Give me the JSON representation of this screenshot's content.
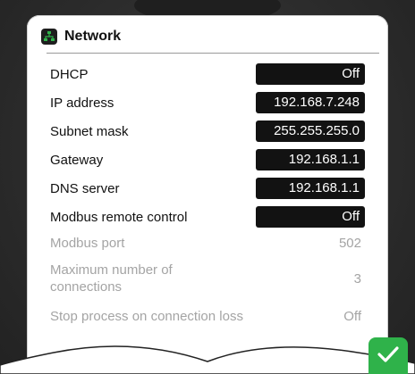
{
  "header": {
    "title": "Network",
    "icon": "network-icon"
  },
  "settings": [
    {
      "label": "DHCP",
      "value": "Off",
      "style": "box"
    },
    {
      "label": "IP address",
      "value": "192.168.7.248",
      "style": "box"
    },
    {
      "label": "Subnet mask",
      "value": "255.255.255.0",
      "style": "box"
    },
    {
      "label": "Gateway",
      "value": "192.168.1.1",
      "style": "box"
    },
    {
      "label": "DNS server",
      "value": "192.168.1.1",
      "style": "box"
    },
    {
      "label": "Modbus remote control",
      "value": "Off",
      "style": "box"
    },
    {
      "label": "Modbus port",
      "value": "502",
      "style": "disabled"
    },
    {
      "label": "Maximum number of connections",
      "value": "3",
      "style": "disabled"
    },
    {
      "label": "Stop process on connection loss",
      "value": "Off",
      "style": "disabled"
    }
  ],
  "confirm": {
    "icon": "checkmark-icon",
    "color": "#2fb24a"
  },
  "colors": {
    "value_box": "#121212",
    "disabled_text": "#a4a4a4"
  }
}
